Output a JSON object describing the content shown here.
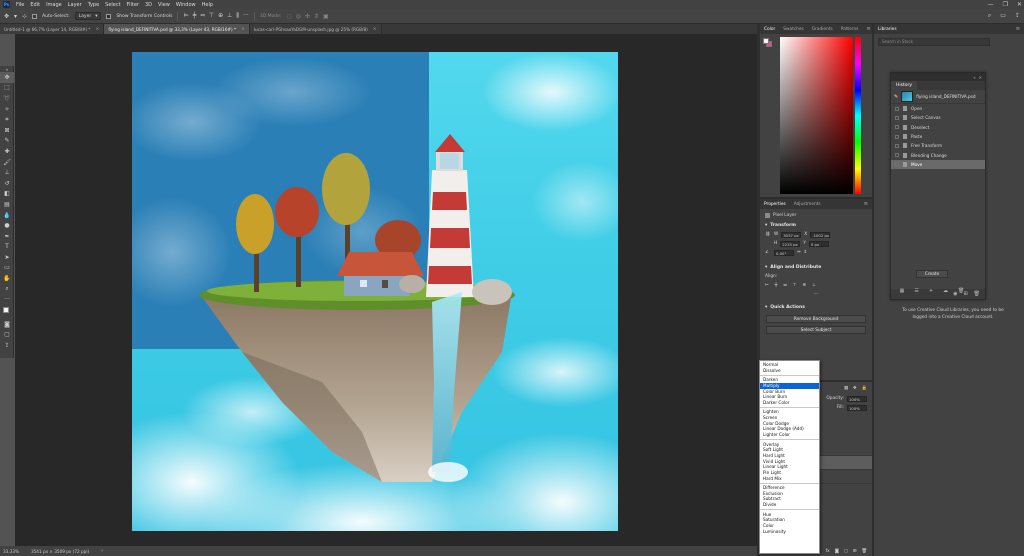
{
  "app": {
    "logo": "Ps"
  },
  "menubar": {
    "items": [
      "File",
      "Edit",
      "Image",
      "Layer",
      "Type",
      "Select",
      "Filter",
      "3D",
      "View",
      "Window",
      "Help"
    ]
  },
  "window_controls": {
    "minimize": "—",
    "restore": "❐",
    "close": "✕"
  },
  "options": {
    "auto_select_label": "Auto-Select:",
    "auto_select_value": "Layer",
    "show_transform_label": "Show Transform Controls",
    "mode_3d": "3D Mode:"
  },
  "tabs": [
    {
      "label": "Untitled-1 @ 66,7% (Layer 14, RGB/8#) *",
      "close": "×"
    },
    {
      "label": "flying island_DEFINITIVA.psd @ 33,3% (Layer 43, RGB/16#) *",
      "close": "×"
    },
    {
      "label": "lucas-carl-PGhsaaYaDGM-unsplash.jpg @ 25% (RGB/8)",
      "close": "×"
    }
  ],
  "statusbar": {
    "zoom": "33,33%",
    "doc_size": "3541 px × 3509 px (72 ppi)"
  },
  "color_panel": {
    "tabs": [
      "Color",
      "Swatches",
      "Gradients",
      "Patterns"
    ]
  },
  "properties_panel": {
    "tabs": [
      "Properties",
      "Adjustments"
    ],
    "layer_type": "Pixel Layer",
    "transform_title": "Transform",
    "w_label": "W",
    "w_value": "3037 px",
    "x_label": "X",
    "x_value": "-1002 px",
    "h_label": "H",
    "h_value": "2225 px",
    "y_label": "Y",
    "y_value": "0 px",
    "angle_value": "0,00°",
    "align_title": "Align and Distribute",
    "align_label": "Align:",
    "quick_actions_title": "Quick Actions",
    "remove_bg": "Remove Background",
    "select_subject": "Select Subject"
  },
  "layers_panel": {
    "opacity_label": "Opacity:",
    "opacity_value": "100%",
    "fill_label": "Fill:",
    "fill_value": "100%"
  },
  "blend_modes": {
    "groups": [
      [
        "Normal",
        "Dissolve"
      ],
      [
        "Darken",
        "Multiply",
        "Color Burn",
        "Linear Burn",
        "Darker Color"
      ],
      [
        "Lighten",
        "Screen",
        "Color Dodge",
        "Linear Dodge (Add)",
        "Lighter Color"
      ],
      [
        "Overlay",
        "Soft Light",
        "Hard Light",
        "Vivid Light",
        "Linear Light",
        "Pin Light",
        "Hard Mix"
      ],
      [
        "Difference",
        "Exclusion",
        "Subtract",
        "Divide"
      ],
      [
        "Hue",
        "Saturation",
        "Color",
        "Luminosity"
      ]
    ],
    "selected": "Multiply"
  },
  "libraries": {
    "title": "Libraries",
    "search_placeholder": "Search in Stock",
    "login_message": "To use Creative Cloud Libraries, you need to be logged into a Creative Cloud account.",
    "create_button": "Create"
  },
  "history": {
    "title": "History",
    "snapshot_label": "flying island_DEFINITIVA.psd",
    "items": [
      "Open",
      "Select Canvas",
      "Deselect",
      "Paste",
      "Free Transform",
      "Blending Change",
      "Move"
    ],
    "selected": "Move"
  },
  "colors": {
    "foreground": "#f4f4f4",
    "background": "#e14b8f",
    "accent": "#0a64d8"
  }
}
